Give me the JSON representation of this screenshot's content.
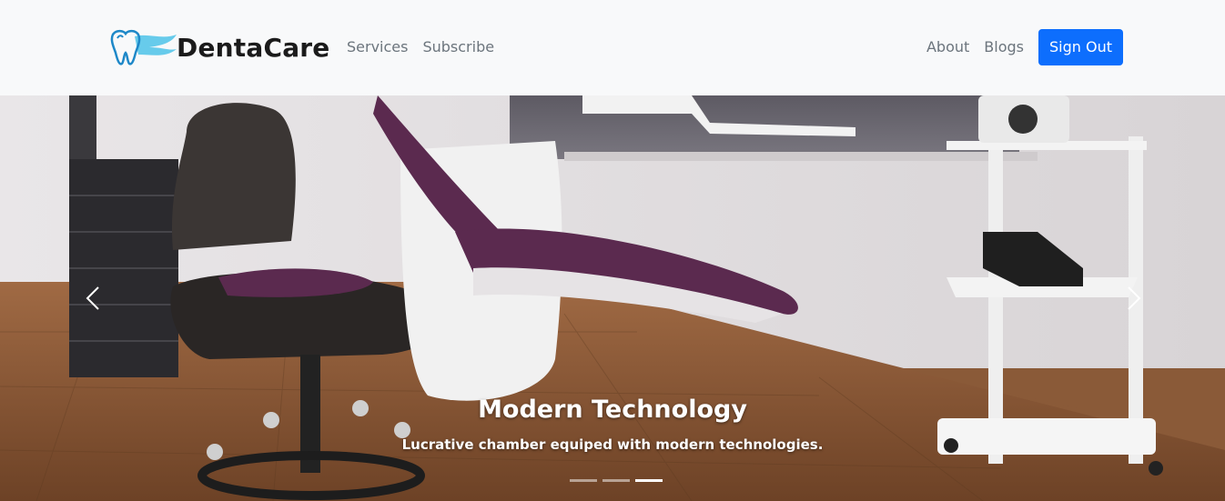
{
  "brand": {
    "name": "DentaCare",
    "logo_icon": "tooth-logo-icon"
  },
  "nav": {
    "left_links": [
      {
        "label": "Services"
      },
      {
        "label": "Subscribe"
      }
    ],
    "right_links": [
      {
        "label": "About"
      },
      {
        "label": "Blogs"
      }
    ],
    "signout_label": "Sign Out"
  },
  "hero": {
    "image_description": "dental clinic chair room",
    "caption_title": "Modern Technology",
    "caption_text": "Lucrative chamber equiped with modern technologies.",
    "prev_icon": "chevron-left-icon",
    "next_icon": "chevron-right-icon",
    "active_slide_index": 2,
    "slide_count": 3
  },
  "colors": {
    "primary": "#0d6efd",
    "navbar_bg": "#f8f9fa",
    "nav_text": "#6c757d",
    "chair_purple": "#5b2a4f"
  }
}
